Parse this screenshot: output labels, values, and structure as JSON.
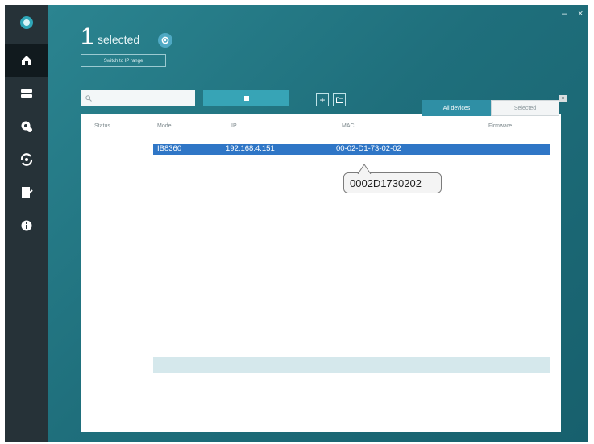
{
  "header": {
    "count": "1",
    "selected_label": "selected",
    "switch_button_label": "Switch to IP range"
  },
  "search": {
    "placeholder": ""
  },
  "tabs": [
    {
      "label": "All devices",
      "active": true
    },
    {
      "label": "Selected",
      "active": false
    }
  ],
  "table": {
    "columns": [
      "Status",
      "Model",
      "IP",
      "MAC",
      "Firmware"
    ],
    "selected_row": {
      "model": "IB8360",
      "ip": "192.168.4.151",
      "mac": "00-02-D1-73-02-02",
      "firmware": ""
    },
    "rows": [
      {
        "model": "IB8360",
        "ip": "192.168.4.151",
        "mac": "00-02-D1-73-02-02",
        "firmware": ""
      },
      {
        "model": "",
        "ip": "",
        "mac": "",
        "firmware": ""
      },
      {
        "model": "",
        "ip": "",
        "mac": "",
        "firmware": ""
      },
      {
        "model": "",
        "ip": "",
        "mac": "",
        "firmware": ""
      },
      {
        "model": "",
        "ip": "",
        "mac": "",
        "firmware": ""
      },
      {
        "model": "",
        "ip": "",
        "mac": "",
        "firmware": ""
      },
      {
        "model": "",
        "ip": "",
        "mac": "",
        "firmware": ""
      },
      {
        "model": "",
        "ip": "",
        "mac": "",
        "firmware": ""
      },
      {
        "model": "",
        "ip": "",
        "mac": "",
        "firmware": ""
      },
      {
        "model": "",
        "ip": "",
        "mac": "",
        "firmware": ""
      },
      {
        "model": "",
        "ip": "",
        "mac": "",
        "firmware": ""
      },
      {
        "model": "",
        "ip": "",
        "mac": "",
        "firmware": ""
      }
    ]
  },
  "tooltip": {
    "text": "0002D1730202"
  },
  "sidebar": {
    "icons": [
      "logo-icon",
      "home-icon",
      "devices-icon",
      "settings-icon",
      "sync-icon",
      "report-icon",
      "info-icon"
    ]
  },
  "colors": {
    "sidebar": "#263238",
    "accent": "#2f8fa5",
    "selection": "#2f76c6",
    "highlight_row": "#d5e8ec"
  }
}
